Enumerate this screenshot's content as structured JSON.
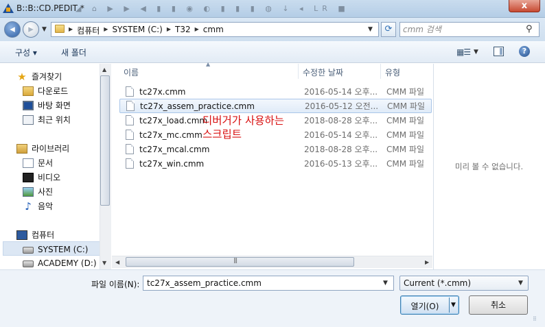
{
  "window": {
    "title": "B::B::CD.PEDIT *",
    "faded_toolbar": "◢ ⌂ ▶ ▶ ◀ ▮ ▮ ◉ ◐ ▮ ▮ ▮ ◍ ↓ ◂ LR ■",
    "close_glyph": "x"
  },
  "address": {
    "crumbs": [
      "컴퓨터",
      "SYSTEM (C:)",
      "T32",
      "cmm"
    ],
    "search_placeholder": "cmm 검색"
  },
  "toolbar": {
    "organize_label": "구성 ▾",
    "new_folder_label": "새 폴더",
    "help_glyph": "?"
  },
  "nav": {
    "favorites_label": "즐겨찾기",
    "downloads_label": "다운로드",
    "desktop_label": "바탕 화면",
    "recent_label": "최근 위치",
    "libraries_label": "라이브러리",
    "documents_label": "문서",
    "videos_label": "비디오",
    "pictures_label": "사진",
    "music_label": "음악",
    "computer_label": "컴퓨터",
    "system_label": "SYSTEM (C:)",
    "academy_label": "ACADEMY (D:)"
  },
  "columns": {
    "name": "이름",
    "date": "수정한 날짜",
    "type": "유형"
  },
  "files": [
    {
      "name": "tc27x.cmm",
      "date": "2016-05-14 오후...",
      "type": "CMM 파일"
    },
    {
      "name": "tc27x_assem_practice.cmm",
      "date": "2016-05-12 오전...",
      "type": "CMM 파일"
    },
    {
      "name": "tc27x_load.cmm",
      "date": "2018-08-28 오후...",
      "type": "CMM 파일"
    },
    {
      "name": "tc27x_mc.cmm",
      "date": "2016-05-14 오후...",
      "type": "CMM 파일"
    },
    {
      "name": "tc27x_mcal.cmm",
      "date": "2018-08-28 오후...",
      "type": "CMM 파일"
    },
    {
      "name": "tc27x_win.cmm",
      "date": "2016-05-13 오후...",
      "type": "CMM 파일"
    }
  ],
  "annotation": {
    "line1": "디버거가 사용하는",
    "line2": "스크립트",
    "color": "#d81010"
  },
  "preview": {
    "no_preview": "미리 볼 수 없습니다."
  },
  "bottom": {
    "filename_label": "파일 이름(N):",
    "filename_value": "tc27x_assem_practice.cmm",
    "filter_value": "Current (*.cmm)",
    "open_label": "열기(O)",
    "cancel_label": "취소"
  }
}
